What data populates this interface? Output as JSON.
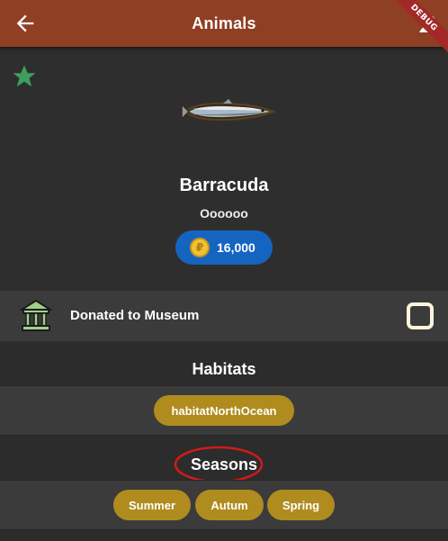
{
  "appbar": {
    "title": "Animals",
    "debug_label": "DEBUG",
    "color": "#8f3f24"
  },
  "item": {
    "name": "Barracuda",
    "catchphrase": "Oooooo",
    "price": "16,000",
    "favorite_icon": "star-icon",
    "image_icon": "fish-icon"
  },
  "donated": {
    "label": "Donated to Museum",
    "checked": false
  },
  "habitats": {
    "title": "Habitats",
    "chips": [
      "habitatNorthOcean"
    ]
  },
  "seasons": {
    "title": "Seasons",
    "chips": [
      "Summer",
      "Autum",
      "Spring"
    ]
  },
  "colors": {
    "chip": "#b08c1f",
    "price_pill": "#1565c0",
    "star": "#3e9e5e",
    "annotation": "#d11a1a"
  }
}
